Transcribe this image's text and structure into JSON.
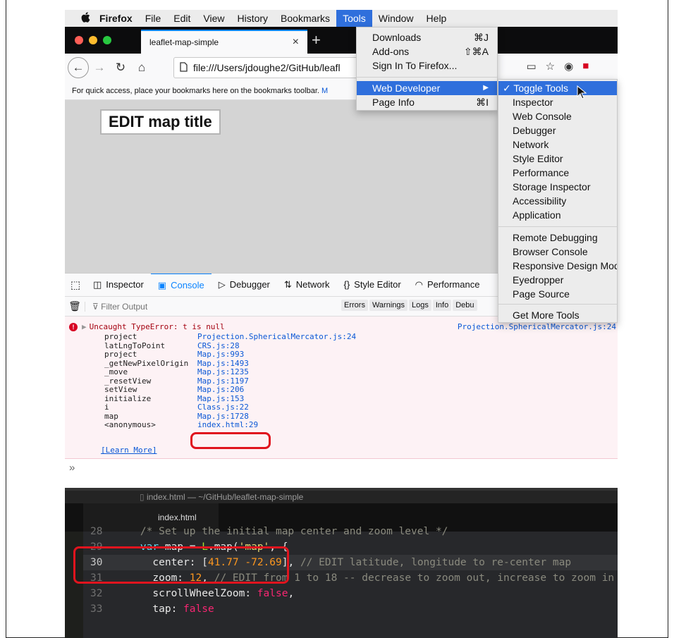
{
  "menubar": {
    "items": [
      "Firefox",
      "File",
      "Edit",
      "View",
      "History",
      "Bookmarks",
      "Tools",
      "Window",
      "Help"
    ]
  },
  "browser": {
    "tab_title": "leaflet-map-simple",
    "tab_close": "×",
    "new_tab": "+",
    "url": "file:///Users/jdoughe2/GitHub/leafl",
    "bookmarks_hint": "For quick access, place your bookmarks here on the bookmarks toolbar.",
    "bookmarks_link": "M"
  },
  "page": {
    "map_title": "EDIT map title"
  },
  "devtools": {
    "tabs": [
      "Inspector",
      "Console",
      "Debugger",
      "Network",
      "Style Editor",
      "Performance"
    ],
    "filter_placeholder": "Filter Output",
    "filter_pills": [
      "Errors",
      "Warnings",
      "Logs",
      "Info",
      "Debu"
    ],
    "error": {
      "message": "Uncaught TypeError: t is null",
      "source": "Projection.SphericalMercator.js:24",
      "stack": [
        {
          "fn": "project",
          "loc": "Projection.SphericalMercator.js:24"
        },
        {
          "fn": "latLngToPoint",
          "loc": "CRS.js:28"
        },
        {
          "fn": "project",
          "loc": "Map.js:993"
        },
        {
          "fn": "_getNewPixelOrigin",
          "loc": "Map.js:1493"
        },
        {
          "fn": "_move",
          "loc": "Map.js:1235"
        },
        {
          "fn": "_resetView",
          "loc": "Map.js:1197"
        },
        {
          "fn": "setView",
          "loc": "Map.js:206"
        },
        {
          "fn": "initialize",
          "loc": "Map.js:153"
        },
        {
          "fn": "i",
          "loc": "Class.js:22"
        },
        {
          "fn": "map",
          "loc": "Map.js:1728"
        },
        {
          "fn": "<anonymous>",
          "loc": "index.html:29"
        }
      ],
      "learn_more": "[Learn More]"
    },
    "prompt": "»"
  },
  "tools_menu": {
    "items": [
      {
        "label": "Downloads",
        "shortcut": "⌘J"
      },
      {
        "label": "Add-ons",
        "shortcut": "⇧⌘A"
      },
      {
        "label": "Sign In To Firefox...",
        "shortcut": ""
      },
      {
        "label": "Web Developer",
        "shortcut": "▶"
      },
      {
        "label": "Page Info",
        "shortcut": "⌘I"
      }
    ]
  },
  "webdev_menu": {
    "items": [
      "✓ Toggle Tools",
      "Inspector",
      "Web Console",
      "Debugger",
      "Network",
      "Style Editor",
      "Performance",
      "Storage Inspector",
      "Accessibility",
      "Application",
      "Remote Debugging",
      "Browser Console",
      "Responsive Design Mode",
      "Eyedropper",
      "Page Source",
      "Get More Tools"
    ]
  },
  "editor": {
    "window_title": "index.html — ~/GitHub/leaflet-map-simple",
    "tab_label": "index.html",
    "line_numbers": [
      "28",
      "29",
      "30",
      "31",
      "32",
      "33"
    ],
    "lines": {
      "l28": "/* Set up the initial map center and zoom level */",
      "l29_kw": "var",
      "l29_a": " map = ",
      "l29_obj": "L",
      "l29_b": ".map(",
      "l29_str": "'map'",
      "l29_c": ", {",
      "l30_a": "center: [",
      "l30_n1": "41.77",
      "l30_sp": " ",
      "l30_n2": "-72.69",
      "l30_b": "], ",
      "l30_cm": "// EDIT latitude, longitude to re-center map",
      "l31_a": "zoom: ",
      "l31_n": "12",
      "l31_b": ", ",
      "l31_cm": "// EDIT from 1 to 18 -- decrease to zoom out, increase to zoom in",
      "l32_a": "scrollWheelZoom: ",
      "l32_v": "false",
      "l32_b": ",",
      "l33_a": "tap: ",
      "l33_v": "false"
    }
  },
  "colors": {
    "accent": "#0a84ff",
    "menu_highlight": "#2f6fdc",
    "annotation": "#e0141e",
    "error_text": "#a4000f"
  }
}
